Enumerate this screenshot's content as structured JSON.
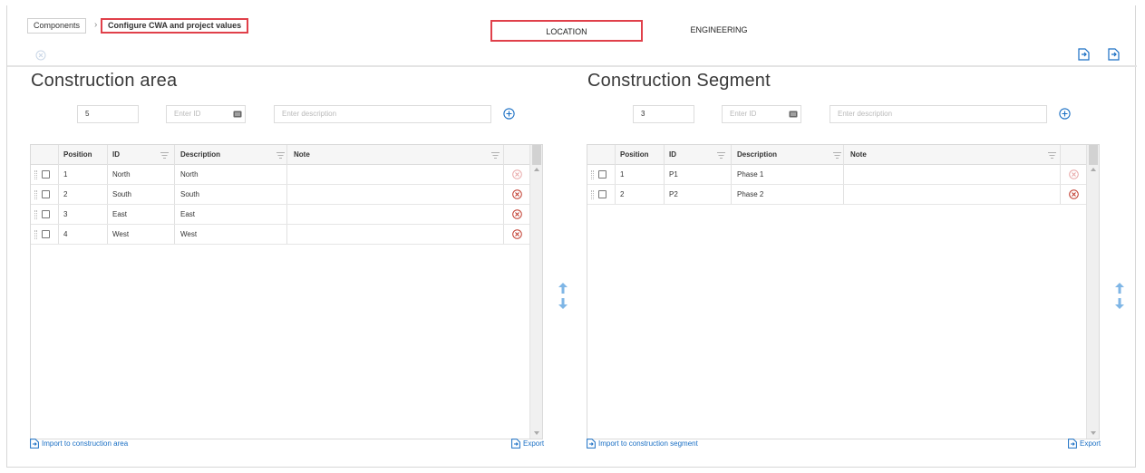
{
  "breadcrumb": {
    "root": "Components",
    "separator": "›",
    "current": "Configure CWA and project values"
  },
  "tabs": [
    {
      "label": "LOCATION"
    },
    {
      "label": "ENGINEERING"
    }
  ],
  "colors": {
    "accent": "#1a6fc4",
    "highlight": "#e0404a",
    "delete": "#c0392b"
  },
  "left": {
    "title": "Construction area",
    "count_value": "5",
    "id_placeholder": "Enter ID",
    "desc_placeholder": "Enter description",
    "columns": [
      "Position",
      "ID",
      "Description",
      "Note"
    ],
    "rows": [
      {
        "position": "1",
        "id": "North",
        "description": "North",
        "note": ""
      },
      {
        "position": "2",
        "id": "South",
        "description": "South",
        "note": ""
      },
      {
        "position": "3",
        "id": "East",
        "description": "East",
        "note": ""
      },
      {
        "position": "4",
        "id": "West",
        "description": "West",
        "note": ""
      }
    ],
    "import_label": "Import to construction area",
    "export_label": "Export"
  },
  "right": {
    "title": "Construction Segment",
    "count_value": "3",
    "id_placeholder": "Enter ID",
    "desc_placeholder": "Enter description",
    "columns": [
      "Position",
      "ID",
      "Description",
      "Note"
    ],
    "rows": [
      {
        "position": "1",
        "id": "P1",
        "description": "Phase 1",
        "note": ""
      },
      {
        "position": "2",
        "id": "P2",
        "description": "Phase 2",
        "note": ""
      }
    ],
    "import_label": "Import to construction segment",
    "export_label": "Export"
  }
}
